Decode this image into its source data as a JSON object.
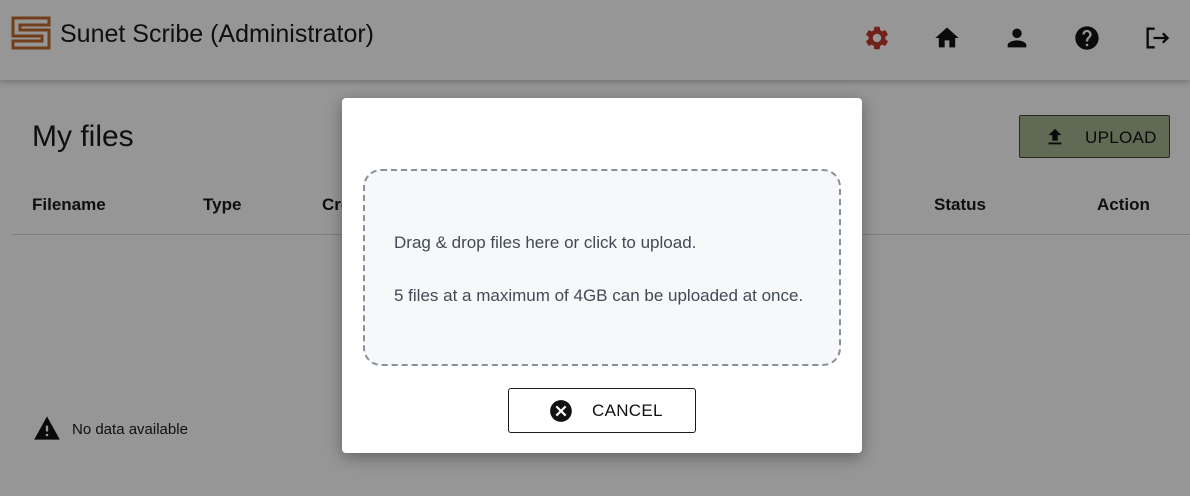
{
  "header": {
    "title": "Sunet Scribe (Administrator)",
    "icons": [
      "settings-gear-icon",
      "home-icon",
      "account-icon",
      "help-icon",
      "logout-icon"
    ],
    "brand_color": "#c06a2b",
    "settings_color": "#c0392b"
  },
  "main": {
    "title": "My files",
    "upload_label": "UPLOAD",
    "columns": [
      "Filename",
      "Type",
      "Cre",
      "Status",
      "Action"
    ],
    "empty_text": "No data available"
  },
  "dialog": {
    "drop_text": "Drag & drop files here or click to upload.",
    "limit_text": "5 files at a maximum of 4GB can be uploaded at once.",
    "cancel_label": "CANCEL"
  },
  "colors": {
    "upload_button": "#a6b590",
    "overlay": "rgba(0,0,0,0.41)",
    "dropzone_bg": "#f6f8fa"
  }
}
